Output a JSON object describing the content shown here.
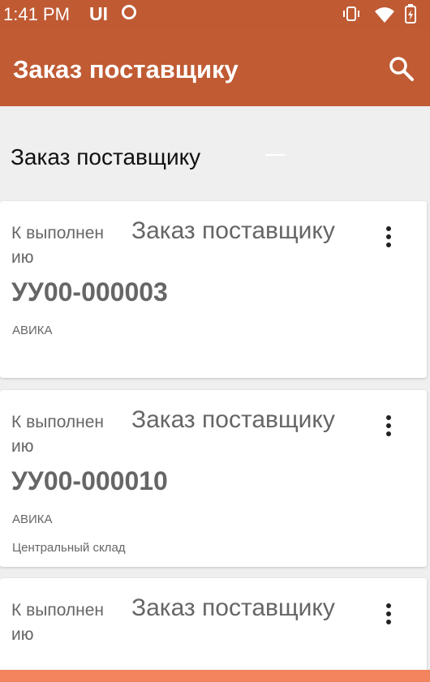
{
  "status_bar": {
    "time": "1:41 PM",
    "ui_label": "UI",
    "icons": [
      "sync-circle-icon",
      "vibrate-icon",
      "wifi-icon",
      "battery-icon"
    ]
  },
  "app_bar": {
    "title": "Заказ поставщику",
    "search_icon": "search-icon",
    "color": "#c05b34"
  },
  "section": {
    "title": "Заказ поставщику"
  },
  "orders": [
    {
      "status": "К выполнен ию",
      "type": "Заказ поставщику",
      "number": "УУ00-000003",
      "counterparty": "АВИКА",
      "warehouse": ""
    },
    {
      "status": "К выполнен ию",
      "type": "Заказ поставщику",
      "number": "УУ00-000010",
      "counterparty": "АВИКА",
      "warehouse": "Центральный склад"
    },
    {
      "status": "К выполнен ию",
      "type": "Заказ поставщику",
      "number": "",
      "counterparty": "",
      "warehouse": ""
    }
  ],
  "colors": {
    "status_bar": "#bf5a33",
    "background": "#efefef",
    "card": "#ffffff",
    "bottom_bar": "#f2855e"
  }
}
